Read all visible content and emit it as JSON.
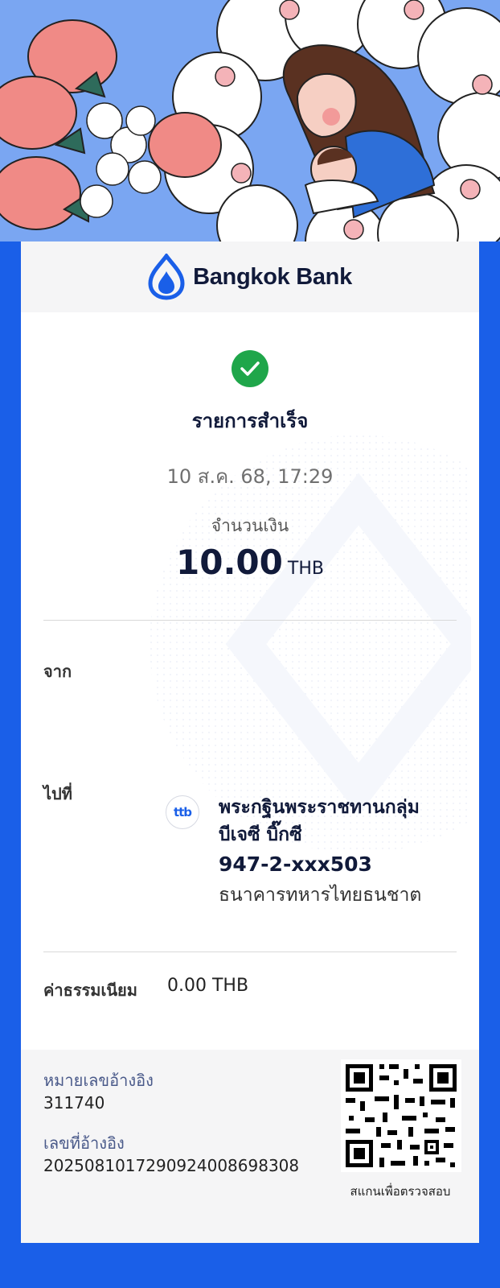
{
  "brand": {
    "name": "Bangkok Bank",
    "color": "#1a5fe8"
  },
  "transaction": {
    "status": "รายการสำเร็จ",
    "datetime": "10 ส.ค. 68, 17:29",
    "amount_label": "จำนวนเงิน",
    "amount": "10.00",
    "currency": "THB"
  },
  "from": {
    "label": "จาก"
  },
  "to": {
    "label": "ไปที่",
    "bank_logo_text": "ttb",
    "name_line1": "พระกฐินพระราชทานกลุ่ม",
    "name_line2": "บีเจซี บิ๊กซี",
    "account": "947-2-xxx503",
    "bank_name": "ธนาคารทหารไทยธนชาต"
  },
  "fee": {
    "label": "ค่าธรรมเนียม",
    "value": "0.00 THB"
  },
  "reference": {
    "ref1_label": "หมายเลขอ้างอิง",
    "ref1_value": "311740",
    "ref2_label": "เลขที่อ้างอิง",
    "ref2_value": "2025081017290924008698308",
    "qr_caption": "สแกนเพื่อตรวจสอบ"
  },
  "colors": {
    "background": "#1a5fe8",
    "success": "#1fa64a",
    "text_dark": "#111a3a"
  }
}
